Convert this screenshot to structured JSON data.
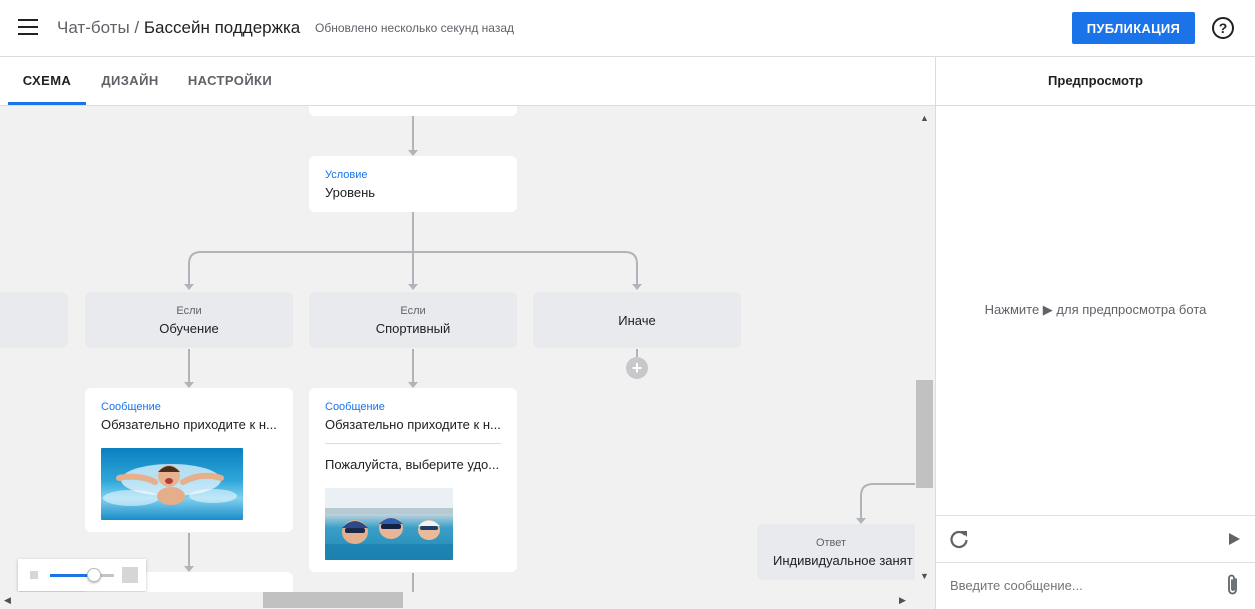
{
  "header": {
    "breadcrumb_root": "Чат-боты",
    "breadcrumb_sep": "/",
    "breadcrumb_current": "Бассейн поддержка",
    "updated": "Обновлено несколько секунд назад",
    "publish_label": "ПУБЛИКАЦИЯ",
    "help_glyph": "?"
  },
  "tabs": [
    {
      "label": "СХЕМА",
      "active": true
    },
    {
      "label": "ДИЗАЙН",
      "active": false
    },
    {
      "label": "НАСТРОЙКИ",
      "active": false
    }
  ],
  "flow": {
    "condition_node": {
      "type": "Условие",
      "text": "Уровень"
    },
    "branches": [
      {
        "type": "Если",
        "text": "Обучение"
      },
      {
        "type": "Если",
        "text": "Спортивный"
      },
      {
        "type": "",
        "text": "Иначе"
      }
    ],
    "add_glyph": "+",
    "message_left": {
      "type": "Сообщение",
      "text": "Обязательно приходите к н..."
    },
    "message_mid": {
      "type": "Сообщение",
      "text": "Обязательно приходите к н...",
      "text2": "Пожалуйста, выберите удо..."
    },
    "reply_node": {
      "type": "Ответ",
      "text": "Индивидуальное занят"
    }
  },
  "preview": {
    "title": "Предпросмотр",
    "hint": "Нажмите ▶ для предпросмотра бота",
    "input_placeholder": "Введите сообщение..."
  },
  "colors": {
    "accent": "#1a73e8",
    "canvas": "#f1f1f1",
    "node_gray": "#e8eaed"
  },
  "icons": {
    "menu": "menu-icon",
    "help": "help-icon",
    "refresh": "refresh-icon",
    "play": "play-icon",
    "attach": "attach-icon"
  }
}
